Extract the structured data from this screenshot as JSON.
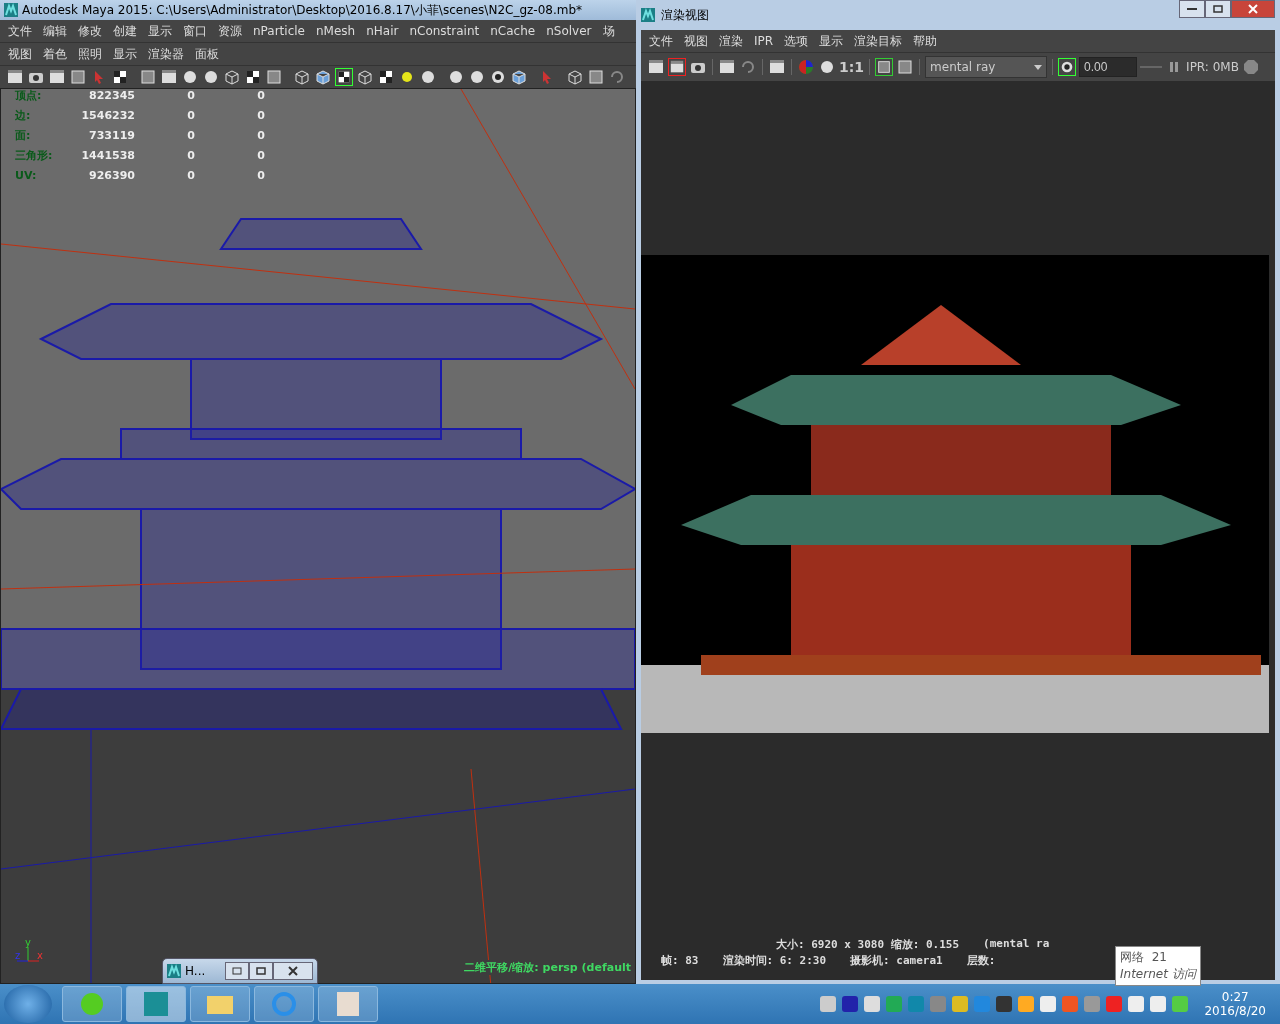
{
  "maya_window": {
    "title": "Autodesk Maya 2015: C:\\Users\\Administrator\\Desktop\\2016.8.17\\小菲\\scenes\\N2C_gz-08.mb*",
    "menu": [
      "文件",
      "编辑",
      "修改",
      "创建",
      "显示",
      "窗口",
      "资源",
      "nParticle",
      "nMesh",
      "nHair",
      "nConstraint",
      "nCache",
      "nSolver",
      "场"
    ],
    "panel_menu": [
      "视图",
      "着色",
      "照明",
      "显示",
      "渲染器",
      "面板"
    ],
    "stats": [
      {
        "label": "顶点:",
        "values": [
          "822345",
          "0",
          "0"
        ]
      },
      {
        "label": "边:",
        "values": [
          "1546232",
          "0",
          "0"
        ]
      },
      {
        "label": "面:",
        "values": [
          "733119",
          "0",
          "0"
        ]
      },
      {
        "label": "三角形:",
        "values": [
          "1441538",
          "0",
          "0"
        ]
      },
      {
        "label": "UV:",
        "values": [
          "926390",
          "0",
          "0"
        ]
      }
    ],
    "axes": [
      "y",
      "z",
      "x"
    ],
    "camera_label": "二维平移/缩放: persp (default"
  },
  "render_window": {
    "title": "渲染视图",
    "menu": [
      "文件",
      "视图",
      "渲染",
      "IPR",
      "选项",
      "显示",
      "渲染目标",
      "帮助"
    ],
    "ratio": "1:1",
    "renderer": "mental ray",
    "exposure": "0.00",
    "ipr": "IPR: 0MB",
    "info": [
      [
        "大小: 6920 x 3080 缩放: 0.155",
        "(mental ra"
      ],
      [
        "帧: 83",
        "渲染时间: 6: 2:30",
        "摄影机: camera1",
        "层数:"
      ]
    ]
  },
  "floating_window": {
    "title": "H..."
  },
  "tooltip": {
    "lines": [
      "网络  21",
      "Internet 访问"
    ]
  },
  "taskbar": {
    "time": "0:27",
    "date": "2016/8/20",
    "apps": [
      {
        "kind": "browser",
        "selected": false
      },
      {
        "kind": "maya",
        "selected": true
      },
      {
        "kind": "folder",
        "selected": false
      },
      {
        "kind": "cloud",
        "selected": false
      },
      {
        "kind": "photo",
        "selected": false
      }
    ]
  }
}
